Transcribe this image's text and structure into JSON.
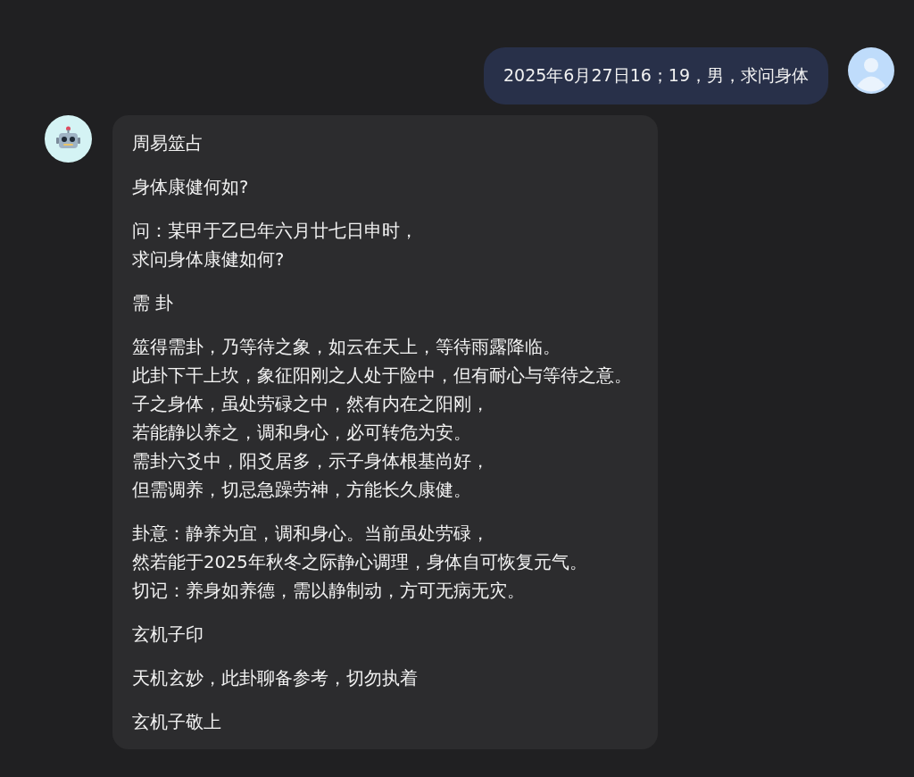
{
  "messages": [
    {
      "kind": "user",
      "text": "2025年6月27日16；19，男，求问身体"
    },
    {
      "kind": "bot",
      "paragraphs": [
        [
          "周易筮占"
        ],
        [
          "身体康健何如?"
        ],
        [
          "问：某甲于乙巳年六月廿七日申时，",
          "求问身体康健如何?"
        ],
        [
          "需 卦"
        ],
        [
          "筮得需卦，乃等待之象，如云在天上，等待雨露降临。",
          "此卦下干上坎，象征阳刚之人处于险中，但有耐心与等待之意。",
          "子之身体，虽处劳碌之中，然有内在之阳刚，",
          "若能静以养之，调和身心，必可转危为安。",
          "需卦六爻中，阳爻居多，示子身体根基尚好，",
          "但需调养，切忌急躁劳神，方能长久康健。"
        ],
        [
          "卦意：静养为宜，调和身心。当前虽处劳碌，",
          "然若能于2025年秋冬之际静心调理，身体自可恢复元气。",
          "切记：养身如养德，需以静制动，方可无病无灾。"
        ],
        [
          "玄机子印"
        ],
        [
          "天机玄妙，此卦聊备参考，切勿执着"
        ],
        [
          "玄机子敬上"
        ]
      ]
    }
  ]
}
